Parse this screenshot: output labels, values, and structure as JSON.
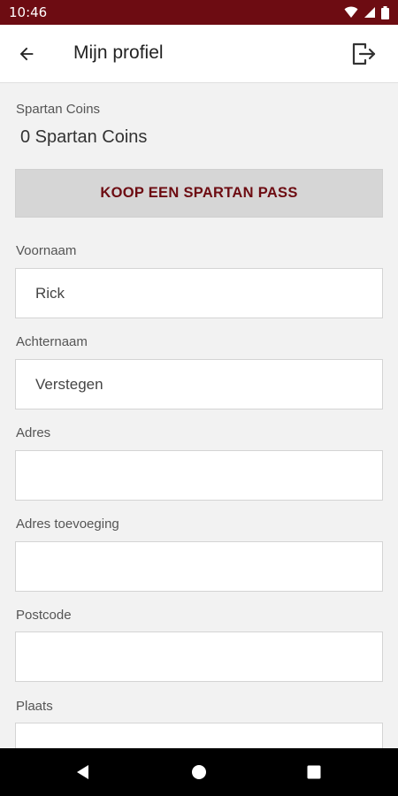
{
  "status_bar": {
    "time": "10:46"
  },
  "header": {
    "title": "Mijn profiel",
    "back_icon": "arrow-left-icon",
    "logout_icon": "logout-icon"
  },
  "coins": {
    "label": "Spartan Coins",
    "value": "0 Spartan Coins"
  },
  "buy_button": {
    "label": "KOOP EEN SPARTAN PASS"
  },
  "fields": [
    {
      "label": "Voornaam",
      "value": "Rick"
    },
    {
      "label": "Achternaam",
      "value": "Verstegen"
    },
    {
      "label": "Adres",
      "value": ""
    },
    {
      "label": "Adres toevoeging",
      "value": ""
    },
    {
      "label": "Postcode",
      "value": ""
    },
    {
      "label": "Plaats",
      "value": ""
    }
  ],
  "colors": {
    "brand": "#6d0c12",
    "background": "#f2f2f2",
    "button_bg": "#d6d6d6"
  }
}
